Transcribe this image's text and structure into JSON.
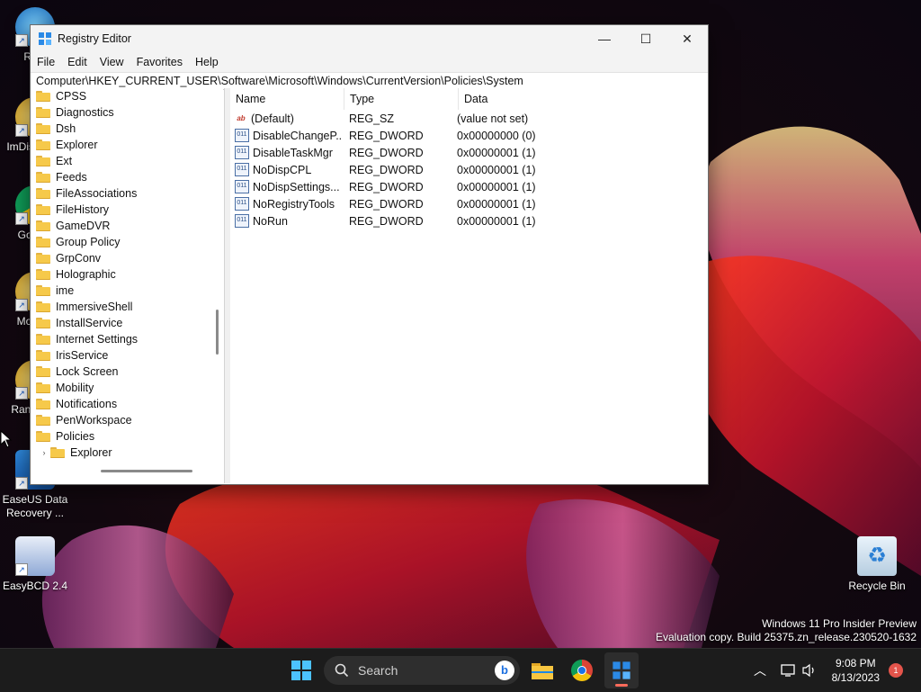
{
  "window": {
    "title": "Registry Editor",
    "minimize": "—",
    "maximize": "☐",
    "close": "✕"
  },
  "menu": [
    "File",
    "Edit",
    "View",
    "Favorites",
    "Help"
  ],
  "address": "Computer\\HKEY_CURRENT_USER\\Software\\Microsoft\\Windows\\CurrentVersion\\Policies\\System",
  "tree": [
    {
      "label": "CPSS"
    },
    {
      "label": "Diagnostics"
    },
    {
      "label": "Dsh"
    },
    {
      "label": "Explorer"
    },
    {
      "label": "Ext"
    },
    {
      "label": "Feeds"
    },
    {
      "label": "FileAssociations"
    },
    {
      "label": "FileHistory"
    },
    {
      "label": "GameDVR"
    },
    {
      "label": "Group Policy"
    },
    {
      "label": "GrpConv"
    },
    {
      "label": "Holographic"
    },
    {
      "label": "ime"
    },
    {
      "label": "ImmersiveShell"
    },
    {
      "label": "InstallService"
    },
    {
      "label": "Internet Settings"
    },
    {
      "label": "IrisService"
    },
    {
      "label": "Lock Screen"
    },
    {
      "label": "Mobility"
    },
    {
      "label": "Notifications"
    },
    {
      "label": "PenWorkspace"
    },
    {
      "label": "Policies"
    },
    {
      "label": "Explorer"
    }
  ],
  "columns": {
    "name": "Name",
    "type": "Type",
    "data": "Data"
  },
  "values": [
    {
      "icon": "ab",
      "name": "(Default)",
      "type": "REG_SZ",
      "data": "(value not set)"
    },
    {
      "icon": "011",
      "name": "DisableChangeP...",
      "type": "REG_DWORD",
      "data": "0x00000000 (0)"
    },
    {
      "icon": "011",
      "name": "DisableTaskMgr",
      "type": "REG_DWORD",
      "data": "0x00000001 (1)"
    },
    {
      "icon": "011",
      "name": "NoDispCPL",
      "type": "REG_DWORD",
      "data": "0x00000001 (1)"
    },
    {
      "icon": "011",
      "name": "NoDispSettings...",
      "type": "REG_DWORD",
      "data": "0x00000001 (1)"
    },
    {
      "icon": "011",
      "name": "NoRegistryTools",
      "type": "REG_DWORD",
      "data": "0x00000001 (1)"
    },
    {
      "icon": "011",
      "name": "NoRun",
      "type": "REG_DWORD",
      "data": "0x00000001 (1)"
    }
  ],
  "desktop": {
    "icons": [
      {
        "label": "Rem"
      },
      {
        "label": "ImDisk Disk"
      },
      {
        "label": "Go Chr"
      },
      {
        "label": "Moun F"
      },
      {
        "label": "Ran Confi"
      },
      {
        "label": "EaseUS Data Recovery ..."
      },
      {
        "label": "EasyBCD 2.4"
      }
    ],
    "recycle_bin": "Recycle Bin",
    "watermark_line1": "Windows 11 Pro Insider Preview",
    "watermark_line2": "Evaluation copy. Build 25375.zn_release.230520-1632"
  },
  "taskbar": {
    "search_placeholder": "Search",
    "time": "9:08 PM",
    "date": "8/13/2023",
    "notification_count": "1"
  }
}
